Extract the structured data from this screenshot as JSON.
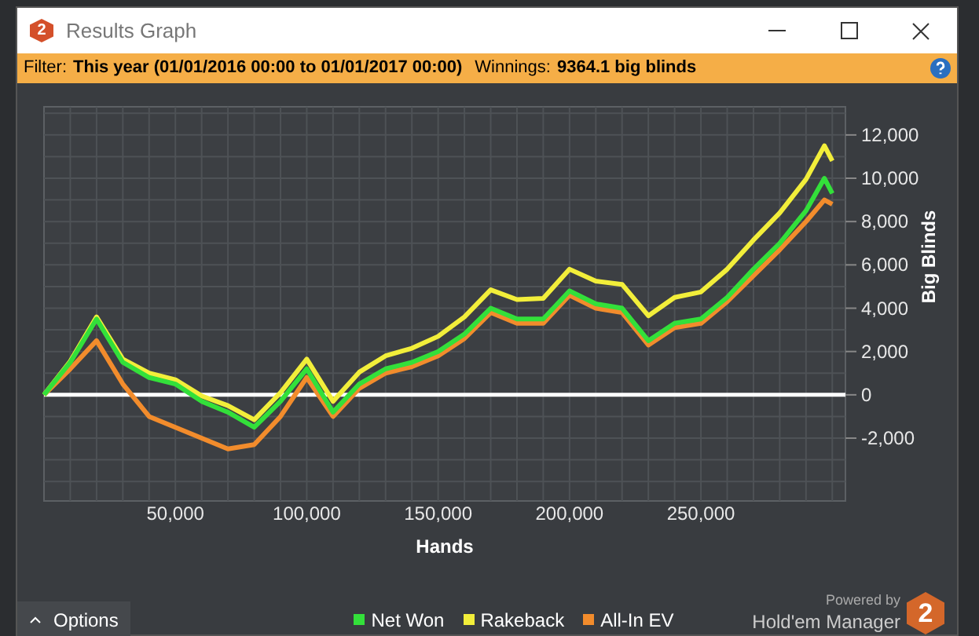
{
  "window": {
    "title": "Results Graph"
  },
  "filter_bar": {
    "label": "Filter:",
    "value": "This year (01/01/2016 00:00 to 01/01/2017 00:00)",
    "winnings_label": "Winnings:",
    "winnings_value": "9364.1 big blinds"
  },
  "chart_data": {
    "type": "line",
    "xlabel": "Hands",
    "ylabel": "Big Blinds",
    "x": [
      0,
      10000,
      20000,
      30000,
      40000,
      50000,
      60000,
      70000,
      80000,
      90000,
      100000,
      110000,
      120000,
      130000,
      140000,
      150000,
      160000,
      170000,
      180000,
      190000,
      200000,
      210000,
      220000,
      230000,
      240000,
      250000,
      260000,
      270000,
      280000,
      290000,
      297000,
      300000
    ],
    "series": [
      {
        "name": "Net Won",
        "color": "#33e03a",
        "values": [
          0,
          1500,
          3500,
          1500,
          800,
          500,
          -300,
          -800,
          -1500,
          -300,
          1200,
          -800,
          500,
          1200,
          1500,
          2000,
          2800,
          4000,
          3500,
          3500,
          4800,
          4200,
          4000,
          2500,
          3300,
          3500,
          4500,
          5800,
          7000,
          8500,
          10000,
          9300
        ]
      },
      {
        "name": "Rakeback",
        "color": "#f2ee3a",
        "values": [
          0,
          1550,
          3600,
          1650,
          1000,
          700,
          -50,
          -500,
          -1150,
          100,
          1650,
          -300,
          1050,
          1800,
          2150,
          2700,
          3600,
          4850,
          4400,
          4450,
          5800,
          5250,
          5100,
          3650,
          4500,
          4750,
          5800,
          7150,
          8400,
          9950,
          11500,
          10800
        ]
      },
      {
        "name": "All-In EV",
        "color": "#f28c2c",
        "values": [
          0,
          1200,
          2500,
          500,
          -1000,
          -1500,
          -2000,
          -2500,
          -2300,
          -1000,
          800,
          -1000,
          300,
          1000,
          1300,
          1800,
          2600,
          3800,
          3300,
          3300,
          4600,
          4000,
          3800,
          2300,
          3100,
          3300,
          4300,
          5500,
          6700,
          8000,
          9000,
          8800
        ]
      }
    ],
    "grid": true,
    "xlim": [
      0,
      305000
    ],
    "ylim": [
      -4900,
      13300
    ],
    "xticks": [
      {
        "value": 50000,
        "label": "50,000"
      },
      {
        "value": 100000,
        "label": "100,000"
      },
      {
        "value": 150000,
        "label": "150,000"
      },
      {
        "value": 200000,
        "label": "200,000"
      },
      {
        "value": 250000,
        "label": "250,000"
      }
    ],
    "yticks": [
      {
        "value": -2000,
        "label": "-2,000"
      },
      {
        "value": 0,
        "label": "0"
      },
      {
        "value": 2000,
        "label": "2,000"
      },
      {
        "value": 4000,
        "label": "4,000"
      },
      {
        "value": 6000,
        "label": "6,000"
      },
      {
        "value": 8000,
        "label": "8,000"
      },
      {
        "value": 10000,
        "label": "10,000"
      },
      {
        "value": 12000,
        "label": "12,000"
      }
    ]
  },
  "options_button": {
    "label": "Options",
    "expanded": false
  },
  "branding": {
    "powered_by": "Powered by",
    "product": "Hold'em Manager",
    "logo_text": "2"
  },
  "title_logo_text": "2"
}
